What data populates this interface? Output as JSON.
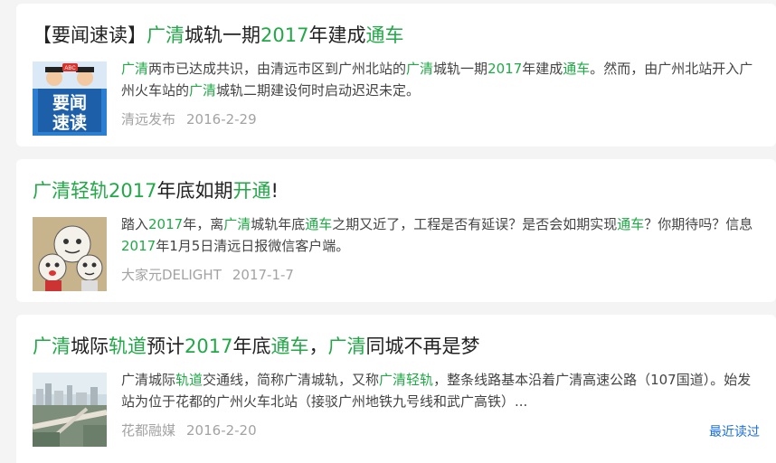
{
  "articles": [
    {
      "title": [
        {
          "t": "【要闻速读】",
          "h": false
        },
        {
          "t": "广清",
          "h": true
        },
        {
          "t": "城轨一期",
          "h": false
        },
        {
          "t": "2017",
          "h": true
        },
        {
          "t": "年建成",
          "h": false
        },
        {
          "t": "通车",
          "h": true
        }
      ],
      "snippet": [
        {
          "t": "广清",
          "h": true
        },
        {
          "t": "两市已达成共识，由清远市区到广州北站的",
          "h": false
        },
        {
          "t": "广清",
          "h": true
        },
        {
          "t": "城轨一期",
          "h": false
        },
        {
          "t": "2017",
          "h": true
        },
        {
          "t": "年建成",
          "h": false
        },
        {
          "t": "通车",
          "h": true
        },
        {
          "t": "。然而，由广州北站开入广州火车站的",
          "h": false
        },
        {
          "t": "广清",
          "h": true
        },
        {
          "t": "城轨二期建设何时启动迟迟未定。",
          "h": false
        }
      ],
      "thumbnail": {
        "line1": "要闻",
        "line2": "速读",
        "badge": "ABC"
      },
      "source": "清远发布",
      "date": "2016-2-29"
    },
    {
      "title": [
        {
          "t": "广清",
          "h": true
        },
        {
          "t": "轻轨",
          "h": true
        },
        {
          "t": "2017",
          "h": true
        },
        {
          "t": "年底如期",
          "h": false
        },
        {
          "t": "开通",
          "h": true
        },
        {
          "t": "!",
          "h": false
        }
      ],
      "snippet": [
        {
          "t": "踏入",
          "h": false
        },
        {
          "t": "2017",
          "h": true
        },
        {
          "t": "年，离",
          "h": false
        },
        {
          "t": "广清",
          "h": true
        },
        {
          "t": "城轨年底",
          "h": false
        },
        {
          "t": "通车",
          "h": true
        },
        {
          "t": "之期又近了，工程是否有延误？是否会如期实现",
          "h": false
        },
        {
          "t": "通车",
          "h": true
        },
        {
          "t": "？你期待吗？信息",
          "h": false
        },
        {
          "t": "2017",
          "h": true
        },
        {
          "t": "年1月5日清远日报微信客户端。",
          "h": false
        }
      ],
      "thumbnail": {},
      "source": "大家元DELIGHT",
      "date": "2017-1-7"
    },
    {
      "title": [
        {
          "t": "广清",
          "h": true
        },
        {
          "t": "城际",
          "h": false
        },
        {
          "t": "轨道",
          "h": true
        },
        {
          "t": "预计",
          "h": false
        },
        {
          "t": "2017",
          "h": true
        },
        {
          "t": "年底",
          "h": false
        },
        {
          "t": "通车",
          "h": true
        },
        {
          "t": "，",
          "h": false
        },
        {
          "t": "广清",
          "h": true
        },
        {
          "t": "同城不再是梦",
          "h": false
        }
      ],
      "snippet": [
        {
          "t": "广清城际",
          "h": false
        },
        {
          "t": "轨道",
          "h": true
        },
        {
          "t": "交通线，简称广清城轨，又称",
          "h": false
        },
        {
          "t": "广清轻轨",
          "h": true
        },
        {
          "t": "，整条线路基本沿着广清高速公路（107国道）。始发站为位于花都的广州火车北站（接驳广州地铁九号线和武广高铁）...",
          "h": false
        }
      ],
      "thumbnail": {},
      "source": "花都融媒",
      "date": "2016-2-20"
    }
  ],
  "recent_link": "最近读过",
  "colors": {
    "highlight": "#21a947",
    "link": "#1a6fd6",
    "meta": "#a3a3a3"
  }
}
